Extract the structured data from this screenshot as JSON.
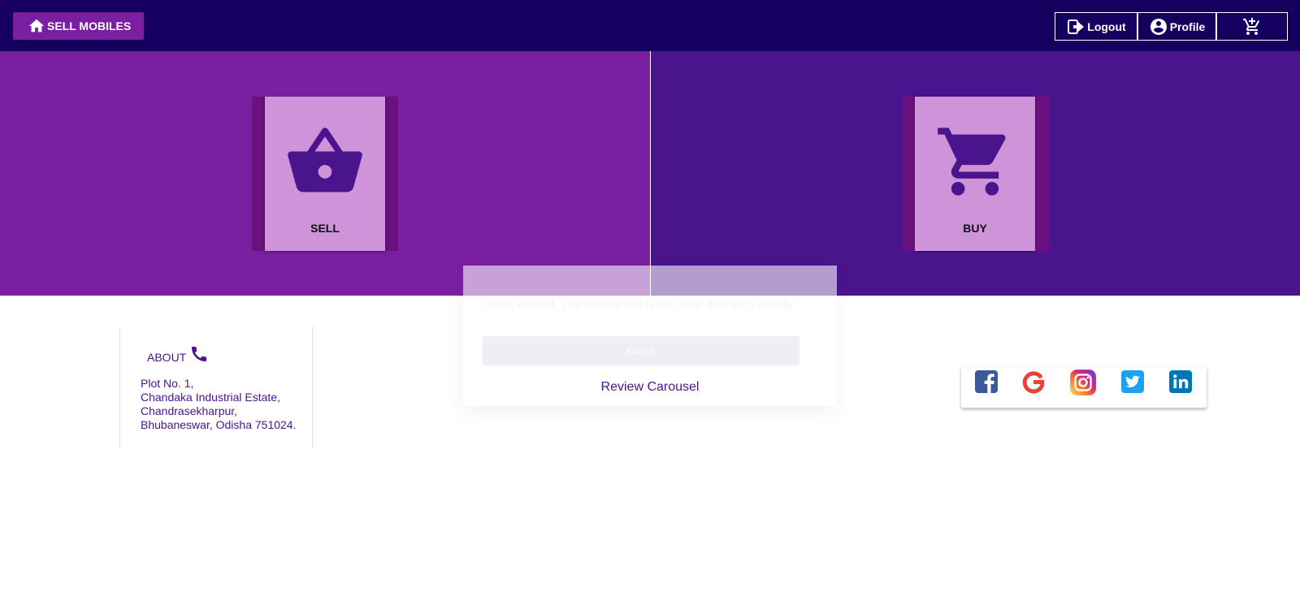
{
  "header": {
    "home_label": "SELL MOBILES",
    "logout_label": "Logout",
    "profile_label": "Profile"
  },
  "hero": {
    "sell_label": "SELL",
    "buy_label": "BUY"
  },
  "about": {
    "title": "ABOUT",
    "address": [
      "Plot No. 1,",
      "Chandaka Industrial Estate,",
      "Chandrasekharpur,",
      "Bhubaneswar, Odisha 751024."
    ]
  },
  "modal": {
    "message": "Order Placed. The mobile will reach your doorstep shortly!",
    "close_label": "Close",
    "review_link": "Review Carousel"
  },
  "social": [
    "facebook-icon",
    "google-icon",
    "instagram-icon",
    "twitter-icon",
    "linkedin-icon"
  ],
  "colors": {
    "topbar": "#150060",
    "accent": "#7b1fa2",
    "deep_purple": "#4a148c",
    "card": "#ce93d8"
  }
}
